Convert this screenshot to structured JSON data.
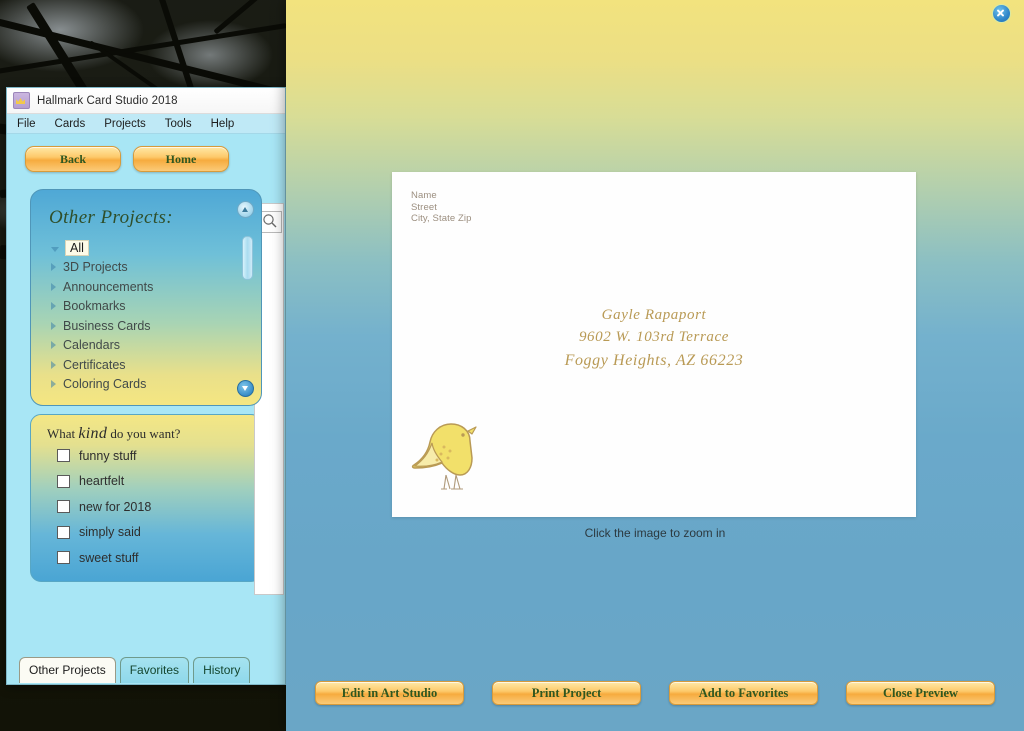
{
  "desktop": {
    "wallpaper_description": "dark tree branches against bright sky"
  },
  "app_window": {
    "title": "Hallmark Card Studio 2018",
    "icon": "hallmark-crown-icon",
    "menu": [
      "File",
      "Cards",
      "Projects",
      "Tools",
      "Help"
    ],
    "nav_buttons": [
      {
        "label": "Back",
        "name": "back-button"
      },
      {
        "label": "Home",
        "name": "home-button"
      }
    ],
    "projects_panel": {
      "title": "Other Projects:",
      "items": [
        {
          "label": "All",
          "selected": true,
          "expandable": false
        },
        {
          "label": "3D Projects",
          "selected": false,
          "expandable": true
        },
        {
          "label": "Announcements",
          "selected": false,
          "expandable": true
        },
        {
          "label": "Bookmarks",
          "selected": false,
          "expandable": true
        },
        {
          "label": "Business Cards",
          "selected": false,
          "expandable": true
        },
        {
          "label": "Calendars",
          "selected": false,
          "expandable": true
        },
        {
          "label": "Certificates",
          "selected": false,
          "expandable": true
        },
        {
          "label": "Coloring Cards",
          "selected": false,
          "expandable": true
        }
      ]
    },
    "kind_panel": {
      "title_prefix": "What",
      "title_emphasis": "kind",
      "title_suffix": "do you want?",
      "options": [
        {
          "label": "funny stuff",
          "checked": false
        },
        {
          "label": "heartfelt",
          "checked": false
        },
        {
          "label": "new for 2018",
          "checked": false
        },
        {
          "label": "simply said",
          "checked": false
        },
        {
          "label": "sweet stuff",
          "checked": false
        }
      ]
    },
    "tabs": [
      {
        "label": "Other Projects",
        "active": true
      },
      {
        "label": "Favorites",
        "active": false
      },
      {
        "label": "History",
        "active": false
      }
    ],
    "search_icon": "search-icon"
  },
  "preview_overlay": {
    "close_icon": "close-icon",
    "envelope": {
      "return_address": {
        "line1": "Name",
        "line2": "Street",
        "line3": "City, State Zip"
      },
      "recipient_address": {
        "line1": "Gayle Rapaport",
        "line2": "9602 W. 103rd Terrace",
        "line3": "Foggy Heights, AZ 66223"
      },
      "illustration": "yellow-bird-icon"
    },
    "zoom_caption": "Click the image to zoom in",
    "actions": [
      {
        "label": "Edit in Art Studio",
        "name": "edit-in-art-studio-button"
      },
      {
        "label": "Print Project",
        "name": "print-project-button"
      },
      {
        "label": "Add to Favorites",
        "name": "add-to-favorites-button"
      },
      {
        "label": "Close Preview",
        "name": "close-preview-button"
      }
    ]
  },
  "colors": {
    "gold_button": "#f6ab3e",
    "panel_blue": "#4fa8d6",
    "panel_yellow": "#f4e785",
    "overlay_top": "#f2e37e",
    "overlay_bottom": "#6aa6c6",
    "script_gold": "#b99a55",
    "app_chrome": "#a8e6f5"
  }
}
